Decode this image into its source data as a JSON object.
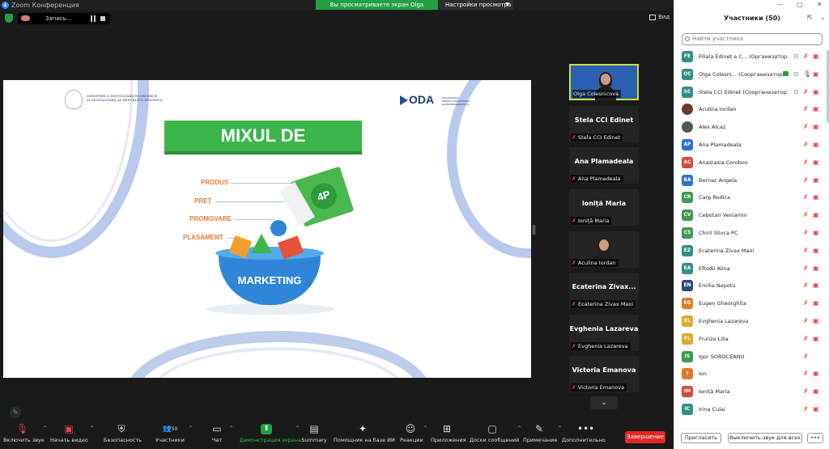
{
  "window": {
    "title": "Zoom Конференция",
    "share_banner": "Вы просматриваете экран Olga Colesnicova",
    "view_settings": "Настройки просмотра"
  },
  "topbar": {
    "recording_label": "Запись...",
    "view_label": "Вид"
  },
  "slide": {
    "ministry_line1": "MINISTERUL DEZVOLTĂRII ECONOMICE",
    "ministry_line2": "ȘI DIGITALIZĂRII AL REPUBLICII MOLDOVA",
    "oda_logo": "ODA",
    "oda_sub_line1": "ORGANIZAȚIA",
    "oda_sub_line2": "PENTRU DEZVOLTAREA",
    "oda_sub_line3": "ANTREPRENORIATULUI",
    "title": "MIXUL DE MARKETING",
    "items": [
      "PRODUS",
      "PREȚ",
      "PROMOVARE",
      "PLASAMENT"
    ],
    "badge": "4P",
    "bowl_text": "MARKETING"
  },
  "video_tiles": [
    {
      "name": "",
      "label": "Olga Colesnicova",
      "video": true
    },
    {
      "name": "Stela CCI Edinet",
      "label": "Stela CCI Edinet",
      "video": false
    },
    {
      "name": "Ana Plamadeala",
      "label": "Ana Plamadeala",
      "video": false
    },
    {
      "name": "Ioniță Maria",
      "label": "Ioniță Maria",
      "video": false
    },
    {
      "name": "",
      "label": "Aculina Iordan",
      "video": true
    },
    {
      "name": "Ecaterina Zivax...",
      "label": "Ecaterina Zivax Maxi",
      "video": false
    },
    {
      "name": "Evghenia Lazareva",
      "label": "Evghenia Lazareva",
      "video": false
    },
    {
      "name": "Victoria Emanova",
      "label": "Victoria Emanova",
      "video": false
    }
  ],
  "toolbar": {
    "unmute": "Включить звук",
    "start_video": "Начать видео",
    "security": "Безопасность",
    "participants": "Участники",
    "participants_count": "50",
    "chat": "Чат",
    "share": "Демонстрация экрана",
    "summary": "Summary",
    "ai_assistant": "Помощник на базе ИИ",
    "reactions": "Реакции",
    "apps": "Приложения",
    "whiteboards": "Доски сообщений",
    "notes": "Примечание",
    "more": "Дополнительно",
    "end": "Завершение"
  },
  "participants_panel": {
    "title": "Участники (50)",
    "search_placeholder": "Найти участника",
    "colors": {
      "green": "#3a9a52",
      "teal": "#2f8f86",
      "blue": "#2c73c7",
      "orange": "#e07a2a",
      "red": "#d24a3a",
      "navy": "#2f4a78",
      "purple": "#7a4fb0"
    },
    "participants": [
      {
        "initials": "FE",
        "name": "Filiala Edineț a C... (Организатор, я)",
        "color": "#2f8f86",
        "icon": "initials",
        "screen": true,
        "mic": "muted",
        "video": "off"
      },
      {
        "initials": "OC",
        "name": "Olga Colesni... (Соорганизатор)",
        "color": "#2f8f86",
        "icon": "initials",
        "screen": true,
        "cc": true,
        "mic": "on",
        "video": "off"
      },
      {
        "initials": "SC",
        "name": "Stela CCI Edinet (Соорганизатор)",
        "color": "#2f8f86",
        "icon": "initials",
        "screen": true,
        "mic": "muted",
        "video": "off"
      },
      {
        "initials": "",
        "name": "Aculina Iordan",
        "color": "#6b3a2a",
        "icon": "photo",
        "mic": "muted",
        "video": "off"
      },
      {
        "initials": "",
        "name": "Alex Alcaz",
        "color": "#555555",
        "icon": "photo",
        "mic": "muted",
        "video": "off"
      },
      {
        "initials": "AP",
        "name": "Ana Plamadeala",
        "color": "#2c73c7",
        "icon": "initials",
        "mic": "muted",
        "video": "off"
      },
      {
        "initials": "AC",
        "name": "Anastasia Corobov",
        "color": "#d24a3a",
        "icon": "initials",
        "mic": "muted",
        "video": "off"
      },
      {
        "initials": "BA",
        "name": "Bernaz Angela",
        "color": "#2c73c7",
        "icon": "initials",
        "mic": "muted",
        "video": "off"
      },
      {
        "initials": "CR",
        "name": "Carp Rodica",
        "color": "#3a9a52",
        "icon": "initials",
        "mic": "muted",
        "video": "off"
      },
      {
        "initials": "CV",
        "name": "Cebotari Veniamin",
        "color": "#3a9a52",
        "icon": "initials",
        "mic": "muted",
        "video": "off"
      },
      {
        "initials": "CS",
        "name": "Chiril Slivca PC",
        "color": "#3a9a52",
        "icon": "initials",
        "mic": "muted",
        "video": "off"
      },
      {
        "initials": "EZ",
        "name": "Ecaterina Zivax Maxi",
        "color": "#2f8f86",
        "icon": "initials",
        "mic": "muted",
        "video": "off"
      },
      {
        "initials": "EA",
        "name": "Eftodii Alina",
        "color": "#2f8f86",
        "icon": "initials",
        "mic": "muted",
        "video": "off"
      },
      {
        "initials": "EN",
        "name": "Emilia Nepotu",
        "color": "#2f4a78",
        "icon": "initials",
        "mic": "muted",
        "video": "off"
      },
      {
        "initials": "EG",
        "name": "Eugen Gheorghita",
        "color": "#e07a2a",
        "icon": "initials",
        "mic": "muted",
        "video": "off"
      },
      {
        "initials": "EL",
        "name": "Evghenia Lazareva",
        "color": "#e0a82a",
        "icon": "initials",
        "mic": "muted",
        "video": "off"
      },
      {
        "initials": "FL",
        "name": "Frunze Lilia",
        "color": "#e0a82a",
        "icon": "initials",
        "mic": "muted",
        "video": "off"
      },
      {
        "initials": "IS",
        "name": "Igor  SOROCEANU",
        "color": "#3a9a52",
        "icon": "initials",
        "mic": "muted",
        "video": "none"
      },
      {
        "initials": "I",
        "name": "Ion",
        "color": "#e07a2a",
        "icon": "initials",
        "mic": "muted",
        "video": "off"
      },
      {
        "initials": "IM",
        "name": "Ioniță Maria",
        "color": "#d24a3a",
        "icon": "initials",
        "mic": "muted",
        "video": "off"
      },
      {
        "initials": "IC",
        "name": "Irina Culai",
        "color": "#2f8f86",
        "icon": "initials",
        "mic": "muted",
        "video": "off"
      }
    ],
    "invite_button": "Пригласить",
    "mute_all_button": "Выключить звук для всех"
  }
}
